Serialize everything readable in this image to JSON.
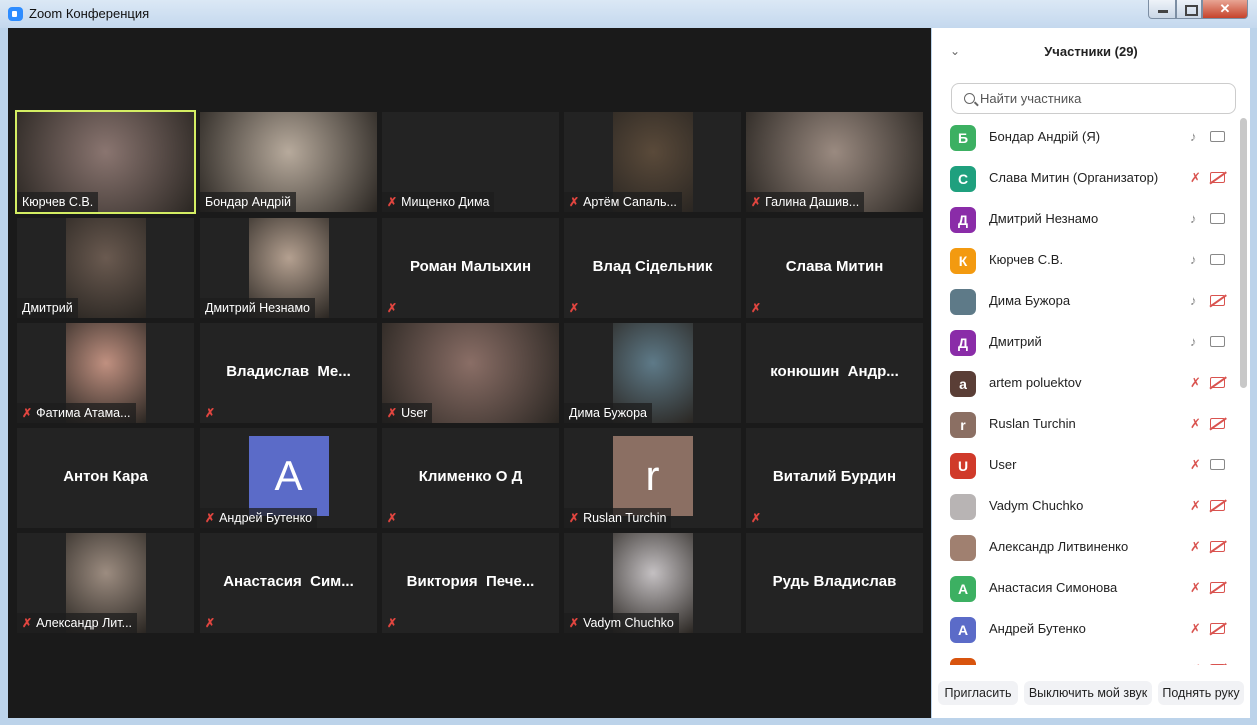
{
  "window": {
    "title": "Zoom Конференция",
    "close": "✕"
  },
  "tiles": [
    {
      "name": "Кюрчев С.В.",
      "muted": false,
      "type": "video",
      "active": true,
      "color": "#8a7570"
    },
    {
      "name": "Бондар Андрій",
      "muted": false,
      "type": "video",
      "color": "#b7aa9c"
    },
    {
      "name": "Мищенко Дима",
      "muted": true,
      "type": "none"
    },
    {
      "name": "Артём Сапаль...",
      "muted": true,
      "type": "photo",
      "color": "#5a4a3a"
    },
    {
      "name": "Галина Дашив...",
      "muted": true,
      "type": "video",
      "color": "#9a8a80"
    },
    {
      "name": "Дмитрий",
      "muted": false,
      "type": "photo",
      "color": "#6a5a50"
    },
    {
      "name": "Дмитрий Незнамо",
      "muted": false,
      "type": "photo",
      "color": "#b4a090"
    },
    {
      "name": "Роман Малыхин",
      "muted": true,
      "type": "name"
    },
    {
      "name": "Влад Сідельник",
      "muted": true,
      "type": "name"
    },
    {
      "name": "Слава Митин",
      "muted": true,
      "type": "name"
    },
    {
      "name": "Фатима Атама...",
      "muted": true,
      "type": "photo",
      "color": "#c09080"
    },
    {
      "name": "Владислав  Ме...",
      "muted": true,
      "type": "name"
    },
    {
      "name": "User",
      "muted": true,
      "type": "video",
      "color": "#8a6e66"
    },
    {
      "name": "Дима Бужора",
      "muted": false,
      "type": "photo",
      "color": "#5e7a88"
    },
    {
      "name": "конюшин  Андр...",
      "muted": false,
      "type": "name",
      "nolabel": true
    },
    {
      "name": "Антон Кара",
      "muted": false,
      "type": "name",
      "nolabel": true
    },
    {
      "name": "Андрей Бутенко",
      "muted": true,
      "type": "avatar",
      "letter": "A",
      "color": "#5b6bc8"
    },
    {
      "name": "Клименко О Д",
      "muted": true,
      "type": "name"
    },
    {
      "name": "Ruslan Turchin",
      "muted": true,
      "type": "avatar",
      "letter": "r",
      "color": "#8b6f63"
    },
    {
      "name": "Виталий Бурдин",
      "muted": true,
      "type": "name"
    },
    {
      "name": "Александр Лит...",
      "muted": true,
      "type": "photo",
      "color": "#9c8c80"
    },
    {
      "name": "Анастасия  Сим...",
      "muted": true,
      "type": "name"
    },
    {
      "name": "Виктория  Пече...",
      "muted": true,
      "type": "name"
    },
    {
      "name": "Vadym Chuchko",
      "muted": true,
      "type": "photo",
      "color": "#c4c0c2"
    },
    {
      "name": "Рудь Владислав",
      "muted": false,
      "type": "name",
      "nolabel": true
    }
  ],
  "panel": {
    "title": "Участники (29)",
    "search_placeholder": "Найти участника",
    "participants": [
      {
        "letter": "Б",
        "name": "Бондар Андрій (Я)",
        "color": "#3cb062",
        "mic": true,
        "cam": true
      },
      {
        "letter": "С",
        "name": "Слава Митин (Организатор)",
        "color": "#1fa07e",
        "mic": false,
        "cam": false
      },
      {
        "letter": "Д",
        "name": "Дмитрий Незнамо",
        "color": "#8a2ca8",
        "mic": true,
        "cam": true
      },
      {
        "letter": "К",
        "name": "Кюрчев С.В.",
        "color": "#f39a10",
        "mic": true,
        "cam": true
      },
      {
        "letter": "",
        "name": "Дима Бужора",
        "color": "#5e7a88",
        "mic": true,
        "cam": false
      },
      {
        "letter": "Д",
        "name": "Дмитрий",
        "color": "#8a2ca8",
        "mic": true,
        "cam": true
      },
      {
        "letter": "a",
        "name": "artem poluektov",
        "color": "#5a3e36",
        "mic": false,
        "cam": false
      },
      {
        "letter": "r",
        "name": "Ruslan Turchin",
        "color": "#8b6f63",
        "mic": false,
        "cam": false
      },
      {
        "letter": "U",
        "name": "User",
        "color": "#d03a2a",
        "mic": false,
        "cam": true
      },
      {
        "letter": "",
        "name": "Vadym Chuchko",
        "color": "#b8b4b4",
        "mic": false,
        "cam": false
      },
      {
        "letter": "",
        "name": "Александр Литвиненко",
        "color": "#a08070",
        "mic": false,
        "cam": false
      },
      {
        "letter": "А",
        "name": "Анастасия Симонова",
        "color": "#3cb062",
        "mic": false,
        "cam": false
      },
      {
        "letter": "A",
        "name": "Андрей Бутенко",
        "color": "#5b6bc8",
        "mic": false,
        "cam": false
      },
      {
        "letter": "",
        "name": "",
        "color": "#d8540e",
        "mic": false,
        "cam": false
      }
    ],
    "invite": "Пригласить",
    "mute_me": "Выключить мой звук",
    "raise_hand": "Поднять руку"
  }
}
